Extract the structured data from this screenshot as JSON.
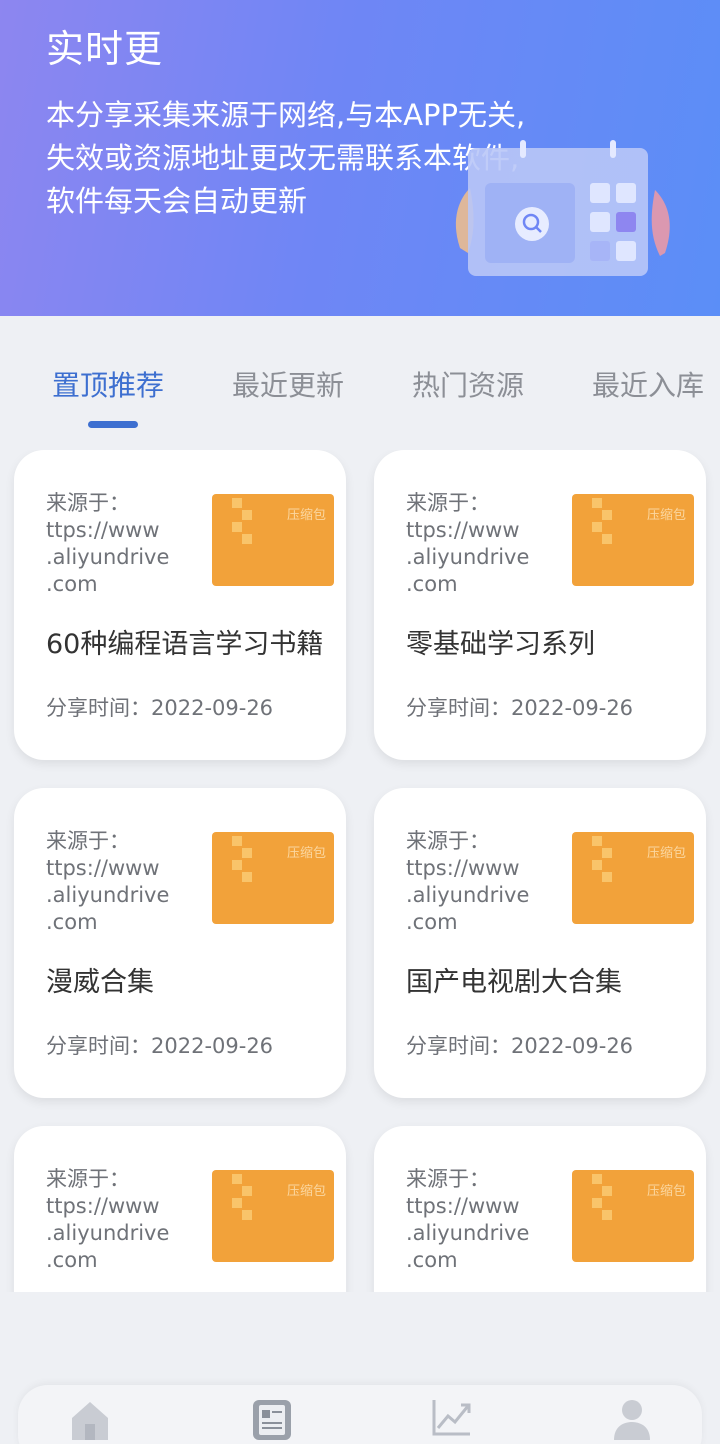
{
  "header": {
    "title": "实时更",
    "description": "本分享采集来源于网络,与本APP无关,\n失效或资源地址更改无需联系本软件,\n软件每天会自动更新"
  },
  "tabs": [
    {
      "label": "置顶推荐",
      "active": true
    },
    {
      "label": "最近更新",
      "active": false
    },
    {
      "label": "热门资源",
      "active": false
    },
    {
      "label": "最近入库",
      "active": false
    }
  ],
  "cards": [
    {
      "source_label": "来源于：",
      "source_lines": [
        "ttps://www",
        ".aliyundrive",
        ".com"
      ],
      "thumb_tag": "压缩包",
      "name": "60种编程语言学习书籍",
      "date": "分享时间：2022-09-26"
    },
    {
      "source_label": "来源于：",
      "source_lines": [
        "ttps://www",
        ".aliyundrive",
        ".com"
      ],
      "thumb_tag": "压缩包",
      "name": "零基础学习系列",
      "date": "分享时间：2022-09-26"
    },
    {
      "source_label": "来源于：",
      "source_lines": [
        "ttps://www",
        ".aliyundrive",
        ".com"
      ],
      "thumb_tag": "压缩包",
      "name": "漫威合集",
      "date": "分享时间：2022-09-26"
    },
    {
      "source_label": "来源于：",
      "source_lines": [
        "ttps://www",
        ".aliyundrive",
        ".com"
      ],
      "thumb_tag": "压缩包",
      "name": "国产电视剧大合集",
      "date": "分享时间：2022-09-26"
    },
    {
      "source_label": "来源于：",
      "source_lines": [
        "ttps://www",
        ".aliyundrive",
        ".com"
      ],
      "thumb_tag": "压缩包",
      "name": "",
      "date": ""
    },
    {
      "source_label": "来源于：",
      "source_lines": [
        "ttps://www",
        ".aliyundrive",
        ".com"
      ],
      "thumb_tag": "压缩包",
      "name": "",
      "date": ""
    }
  ],
  "bottom_nav": [
    {
      "icon": "home-icon"
    },
    {
      "icon": "document-icon"
    },
    {
      "icon": "trend-chart-icon"
    },
    {
      "icon": "user-icon"
    }
  ],
  "colors": {
    "accent": "#3d6fd0",
    "thumb": "#f2a23a",
    "header_start": "#8d86f0",
    "header_end": "#5b8ef7"
  }
}
